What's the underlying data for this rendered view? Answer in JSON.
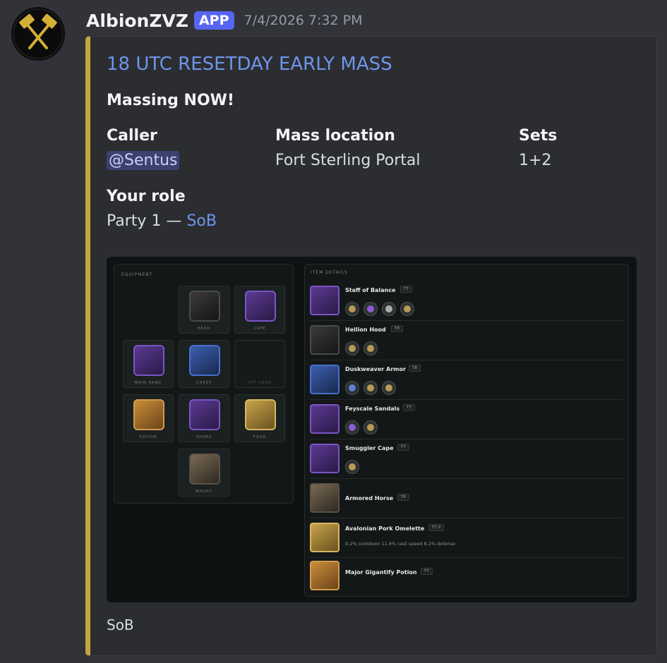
{
  "message": {
    "author": "AlbionZVZ",
    "badge": "APP",
    "timestamp": "7/4/2026 7:32 PM",
    "content": "SoB"
  },
  "embed": {
    "accent_color": "#c9a53d",
    "title": "18 UTC RESETDAY EARLY MASS",
    "description": "Massing NOW!",
    "fields": {
      "caller": {
        "name": "Caller",
        "value": "@Sentus"
      },
      "mass_location": {
        "name": "Mass location",
        "value": "Fort Sterling Portal"
      },
      "sets": {
        "name": "Sets",
        "value": "1+2"
      },
      "your_role": {
        "name": "Your role",
        "value_prefix": "Party 1 —",
        "value_link": "SoB"
      }
    }
  },
  "loadout_image": {
    "equipment_label": "EQUIPMENT",
    "item_details_label": "ITEM DETAILS",
    "slots": {
      "head": "HEAD",
      "cape": "CAPE",
      "main_hand": "MAIN HAND",
      "chest": "CHEST",
      "off_hand": "OFF HAND",
      "potion": "POTION",
      "shoes": "SHOES",
      "food": "FOOD",
      "mount": "MOUNT"
    },
    "items": [
      {
        "name": "Staff of Balance",
        "tier": "T7",
        "icon": "staff-icon",
        "spells": [
          "gold",
          "purple",
          "silver",
          "gold"
        ]
      },
      {
        "name": "Hellion Hood",
        "tier": "T8",
        "icon": "hood-icon",
        "spells": [
          "gold",
          "gold"
        ]
      },
      {
        "name": "Duskweaver Armor",
        "tier": "T8",
        "icon": "armor-icon",
        "spells": [
          "blue",
          "gold",
          "gold"
        ]
      },
      {
        "name": "Feyscale Sandals",
        "tier": "T7",
        "icon": "sandals-icon",
        "spells": [
          "purple",
          "gold"
        ]
      },
      {
        "name": "Smuggler Cape",
        "tier": "T7",
        "icon": "cape-icon",
        "spells": [
          "gold"
        ]
      },
      {
        "name": "Armored Horse",
        "tier": "T6",
        "icon": "horse-icon",
        "spells": []
      },
      {
        "name": "Avalonian Pork Omelette",
        "tier": "T7.3",
        "icon": "omelette-icon",
        "stats": "9.2% cooldown   11.6% cast speed   8.1% defense"
      },
      {
        "name": "Major Gigantify Potion",
        "tier": "T7",
        "icon": "potion-icon",
        "spells": []
      }
    ]
  }
}
